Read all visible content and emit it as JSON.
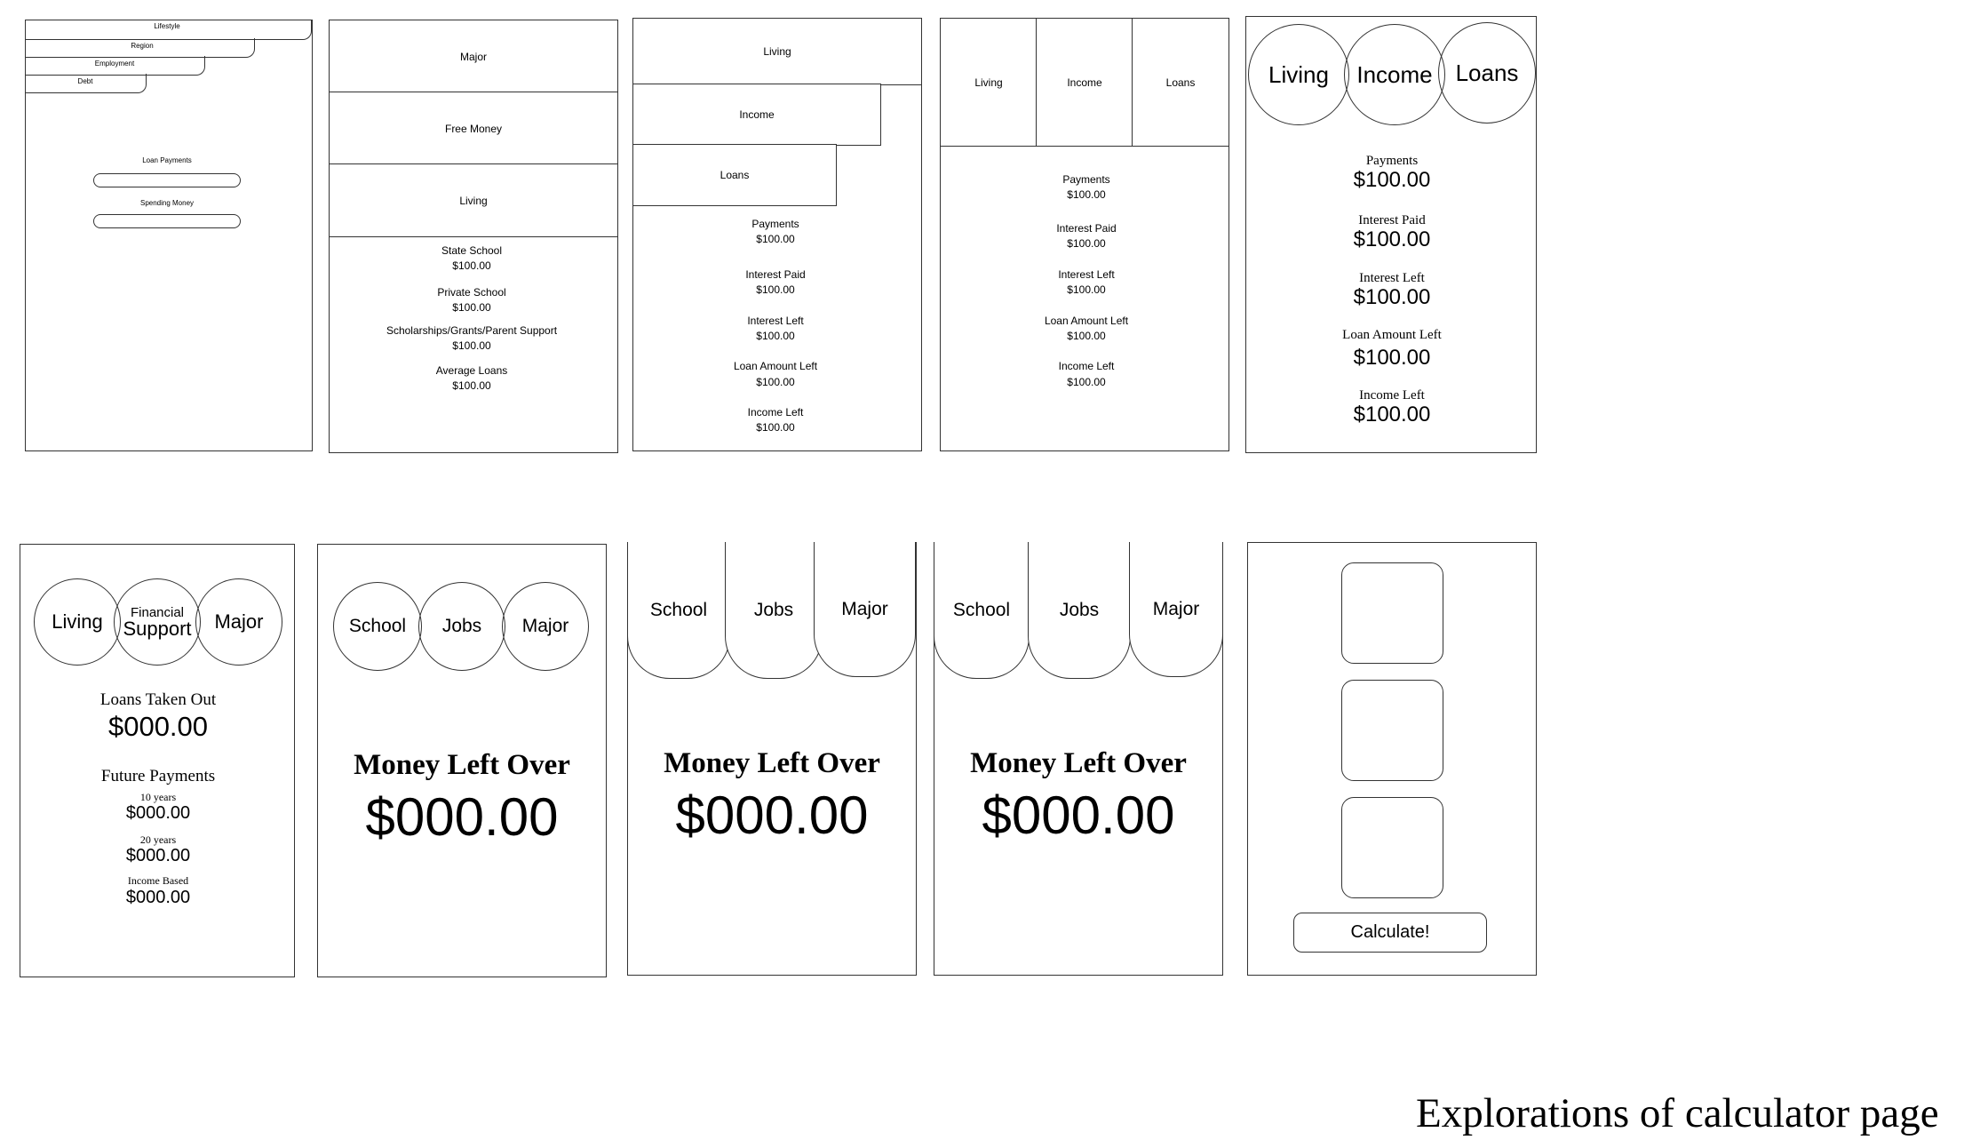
{
  "caption": "Explorations of calculator page",
  "w1": {
    "tabs": [
      "Lifestyle",
      "Region",
      "Employment",
      "Debt"
    ],
    "field1_label": "Loan Payments",
    "field2_label": "Spending Money"
  },
  "w2": {
    "blocks": [
      "Major",
      "Free Money",
      "Living"
    ],
    "stats": [
      {
        "label": "State School",
        "value": "$100.00"
      },
      {
        "label": "Private School",
        "value": "$100.00"
      },
      {
        "label": "Scholarships/Grants/Parent Support",
        "value": "$100.00"
      },
      {
        "label": "Average Loans",
        "value": "$100.00"
      }
    ]
  },
  "w3": {
    "blocks": [
      "Living",
      "Income",
      "Loans"
    ],
    "stats": [
      {
        "label": "Payments",
        "value": "$100.00"
      },
      {
        "label": "Interest Paid",
        "value": "$100.00"
      },
      {
        "label": "Interest Left",
        "value": "$100.00"
      },
      {
        "label": "Loan Amount Left",
        "value": "$100.00"
      },
      {
        "label": "Income Left",
        "value": "$100.00"
      }
    ]
  },
  "w4": {
    "blocks": [
      "Living",
      "Income",
      "Loans"
    ],
    "stats": [
      {
        "label": "Payments",
        "value": "$100.00"
      },
      {
        "label": "Interest Paid",
        "value": "$100.00"
      },
      {
        "label": "Interest Left",
        "value": "$100.00"
      },
      {
        "label": "Loan Amount Left",
        "value": "$100.00"
      },
      {
        "label": "Income Left",
        "value": "$100.00"
      }
    ]
  },
  "w5": {
    "circles": [
      "Living",
      "Income",
      "Loans"
    ],
    "stats": [
      {
        "label": "Payments",
        "value": "$100.00"
      },
      {
        "label": "Interest Paid",
        "value": "$100.00"
      },
      {
        "label": "Interest Left",
        "value": "$100.00"
      },
      {
        "label": "Loan Amount Left",
        "value": "$100.00"
      },
      {
        "label": "Income Left",
        "value": "$100.00"
      }
    ]
  },
  "w6": {
    "circles": [
      "Living",
      "Support",
      "Major"
    ],
    "circle2_top": "Financial",
    "loans_label": "Loans Taken Out",
    "loans_value": "$000.00",
    "future_label": "Future Payments",
    "future": [
      {
        "label": "10 years",
        "value": "$000.00"
      },
      {
        "label": "20 years",
        "value": "$000.00"
      },
      {
        "label": "Income Based",
        "value": "$000.00"
      }
    ]
  },
  "w7": {
    "circles": [
      "School",
      "Jobs",
      "Major"
    ],
    "title": "Money Left Over",
    "value": "$000.00"
  },
  "w8": {
    "tabs": [
      "School",
      "Jobs",
      "Major"
    ],
    "title": "Money Left Over",
    "value": "$000.00"
  },
  "w9": {
    "tabs": [
      "School",
      "Jobs",
      "Major"
    ],
    "title": "Money Left Over",
    "value": "$000.00"
  },
  "w10": {
    "button": "Calculate!"
  }
}
